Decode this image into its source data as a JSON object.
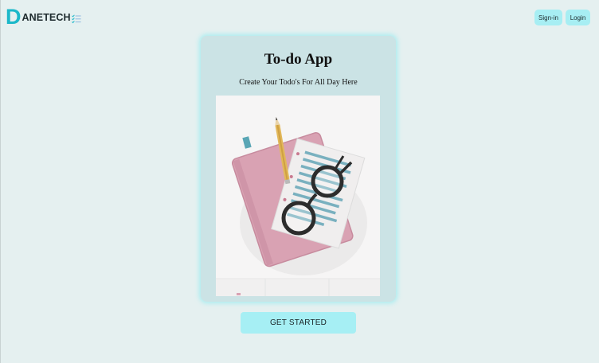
{
  "header": {
    "logo_initial": "D",
    "logo_rest": "ANETECH",
    "logo_icon": "checklist-icon",
    "nav": {
      "signin_label": "Sign-in",
      "login_label": "Login"
    }
  },
  "card": {
    "title": "To-do App",
    "subtitle": "Create Your Todo's For All Day Here",
    "image": "notebook-glasses-pencil-illustration"
  },
  "cta": {
    "label": "GET STARTED"
  },
  "colors": {
    "background": "#e5f0f0",
    "accent": "#a7eef3",
    "brand": "#1bb8c9",
    "card": "#cbe3e5"
  }
}
